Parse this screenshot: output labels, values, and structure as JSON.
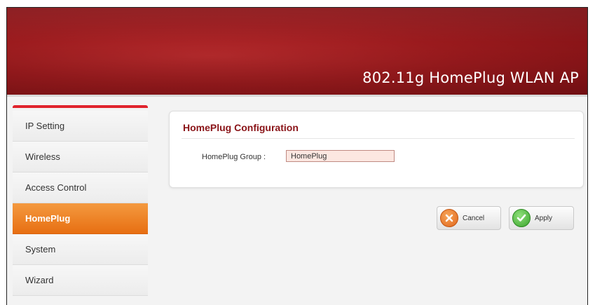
{
  "header": {
    "product_title": "802.11g HomePlug WLAN AP"
  },
  "sidebar": {
    "items": [
      {
        "label": "IP Setting",
        "active": false
      },
      {
        "label": "Wireless",
        "active": false
      },
      {
        "label": "Access Control",
        "active": false
      },
      {
        "label": "HomePlug",
        "active": true
      },
      {
        "label": "System",
        "active": false
      },
      {
        "label": "Wizard",
        "active": false
      }
    ]
  },
  "panel": {
    "title": "HomePlug Configuration",
    "homeplug_group_label": "HomePlug Group :",
    "homeplug_group_value": "HomePlug"
  },
  "actions": {
    "cancel_label": "Cancel",
    "apply_label": "Apply"
  },
  "colors": {
    "banner": "#9a1a1d",
    "active_nav": "#e76f12",
    "panel_title": "#8a1418",
    "input_bg": "#fce7e1"
  },
  "icons": {
    "cancel": "x-circle-icon",
    "apply": "check-circle-icon"
  }
}
